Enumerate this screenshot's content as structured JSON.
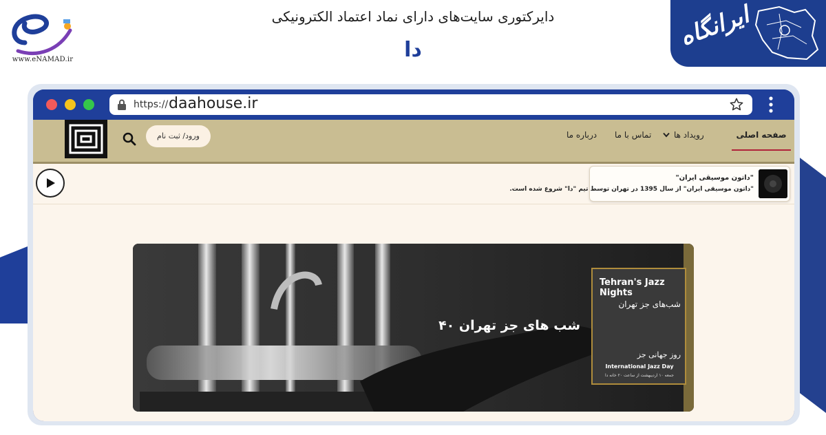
{
  "header": {
    "enamad_caption": "www.eNAMAD.ir",
    "directory_title": "دایرکتوری سایت‌های دارای نماد اعتماد الکترونیکی",
    "site_name": "دا",
    "brand_text": "ایرانگاه"
  },
  "browser": {
    "url_protocol": "https://",
    "url_domain": "daahouse.ir"
  },
  "nav": {
    "items": [
      {
        "label": "صفحه اصلی",
        "active": true
      },
      {
        "label": "رویداد ها",
        "has_dropdown": true
      },
      {
        "label": "تماس با ما"
      },
      {
        "label": "درباره ما"
      }
    ],
    "login_label": "ورود/ ثبت نام"
  },
  "ticker": {
    "title": "\"داتون موسیقی ایران\"",
    "description": "\"داتون موسیقی ایران\" از سال 1395 در تهران توسط تیم \"دا\" شروع شده است."
  },
  "banner": {
    "caption": "شب های جز تهران ۴۰",
    "poster": {
      "title_en": "Tehran's Jazz Nights",
      "title_fa": "شب‌های جز تهران",
      "subtitle_fa": "روز جهانی جز",
      "subtitle_en": "International Jazz Day",
      "date_line": "جمعه ۱۰ اردیبهشت از ساعت ۲۰ خانه دا"
    }
  },
  "colors": {
    "brand_blue": "#1f3f9a",
    "nav_bg": "#c9bd92",
    "content_bg": "#fcf5ec",
    "active_underline": "#b0233a"
  }
}
